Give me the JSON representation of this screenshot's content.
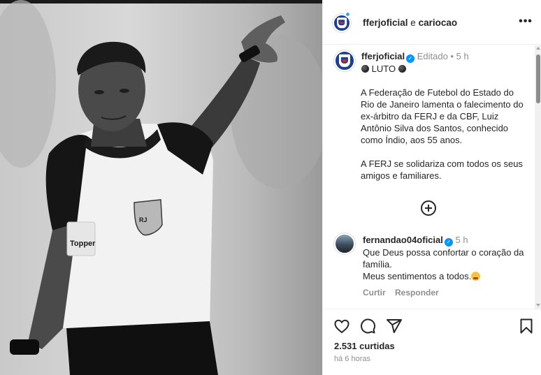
{
  "photo": {
    "subject": "referee portrait (black and white)",
    "sponsor_text": "Topper",
    "badge_text": "RJ"
  },
  "header": {
    "username": "fferjoficial",
    "connector": "e",
    "collaborator": "cariocao",
    "more_icon": "more-horizontal-icon"
  },
  "caption": {
    "username": "fferjoficial",
    "verified_mark": "✓",
    "edited": "Editado",
    "separator": "•",
    "time": "5 h",
    "headline": "LUTO",
    "body": "A Federação de Futebol do Estado do Rio de Janeiro lamenta o falecimento do ex-árbitro da FERJ e da CBF, Luiz Antônio Silva dos Santos, conhecido como Índio, aos 55 anos.\n\nA FERJ se solidariza com todos os seus amigos e familiares."
  },
  "comment": {
    "username": "fernandao04oficial",
    "verified_mark": "✓",
    "time": "5 h",
    "text": "Que Deus possa confortar o coração da família.\nMeus sentimentos a todos.",
    "like_label": "Curtir",
    "reply_label": "Responder"
  },
  "actions": {
    "icons": [
      "heart-icon",
      "comment-icon",
      "share-icon",
      "bookmark-icon"
    ],
    "likes": "2.531 curtidas",
    "posted": "há 6 horas"
  },
  "colors": {
    "verified": "#0095f6",
    "muted": "#8e8e8e",
    "text": "#262626",
    "crest_blue": "#1f3f8a"
  }
}
